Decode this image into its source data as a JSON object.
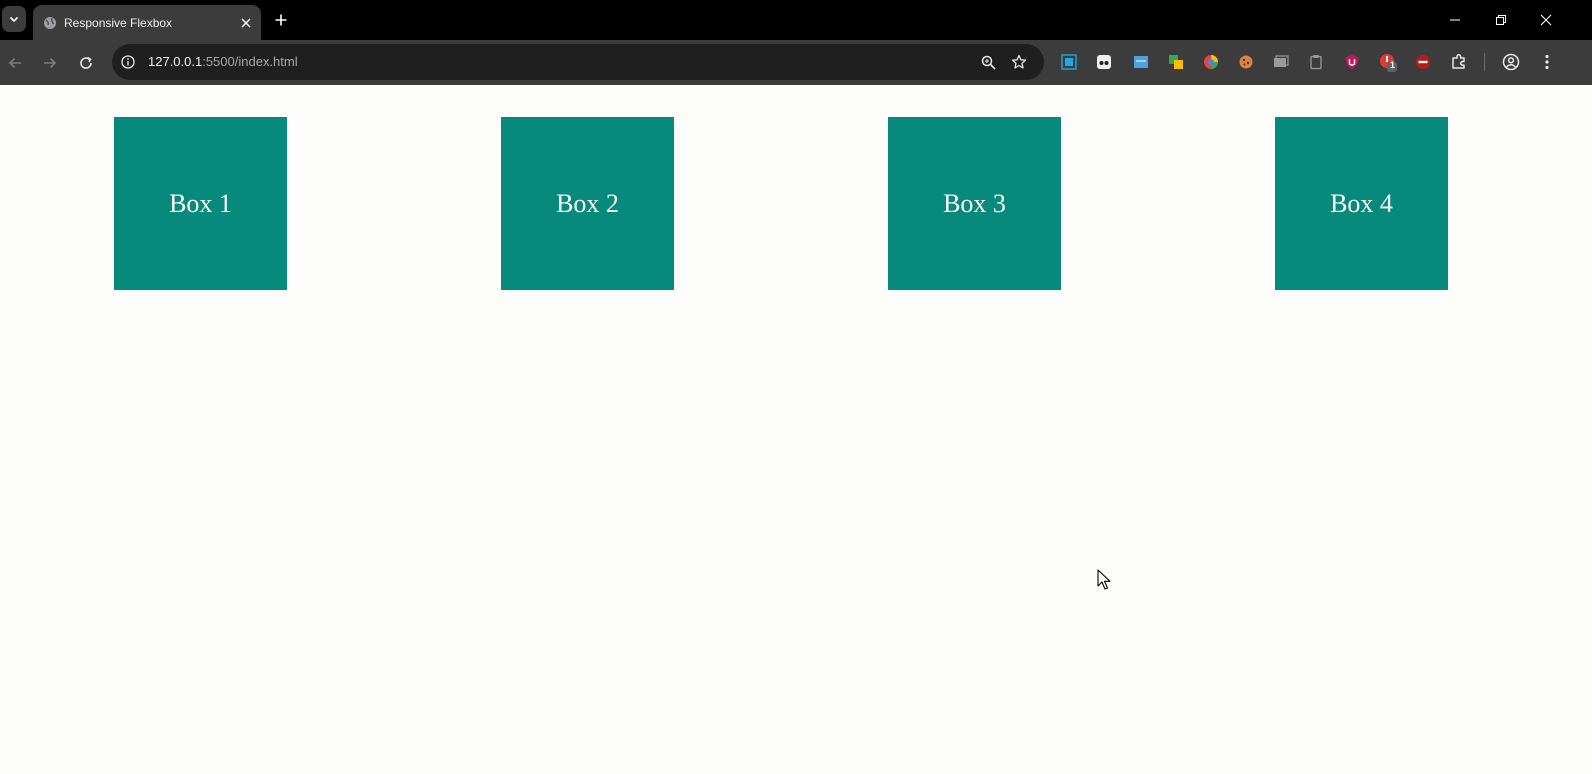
{
  "browser": {
    "tab": {
      "title": "Responsive Flexbox",
      "favicon": "globe-icon"
    },
    "address": {
      "host": "127.0.0.1",
      "path": ":5500/index.html"
    }
  },
  "page": {
    "boxes": [
      {
        "label": "Box 1"
      },
      {
        "label": "Box 2"
      },
      {
        "label": "Box 3"
      },
      {
        "label": "Box 4"
      }
    ]
  },
  "extensions": {
    "badge_count": "1"
  },
  "colors": {
    "box_background": "#07897c",
    "page_background": "#fdfdfb",
    "box_text": "#ffffff"
  }
}
